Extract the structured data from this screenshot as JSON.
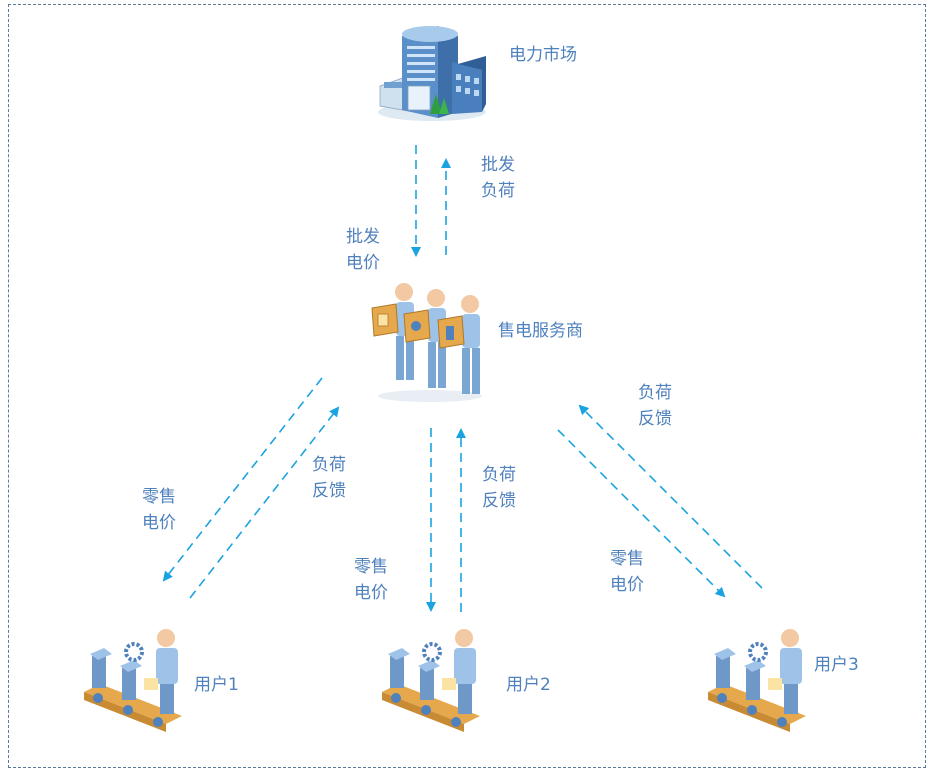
{
  "nodes": {
    "market": "电力市场",
    "retailer": "售电服务商",
    "user1": "用户1",
    "user2": "用户2",
    "user3": "用户3"
  },
  "edges": {
    "market_to_retailer": [
      "批发",
      "电价"
    ],
    "retailer_to_market": [
      "批发",
      "负荷"
    ],
    "retailer_to_user1": [
      "零售",
      "电价"
    ],
    "user1_to_retailer": [
      "负荷",
      "反馈"
    ],
    "retailer_to_user2": [
      "零售",
      "电价"
    ],
    "user2_to_retailer": [
      "负荷",
      "反馈"
    ],
    "retailer_to_user3": [
      "零售",
      "电价"
    ],
    "user3_to_retailer": [
      "负荷",
      "反馈"
    ]
  },
  "colors": {
    "arrow": "#1aa3e0",
    "label": "#4f81bd",
    "frame": "#5b7a99"
  }
}
